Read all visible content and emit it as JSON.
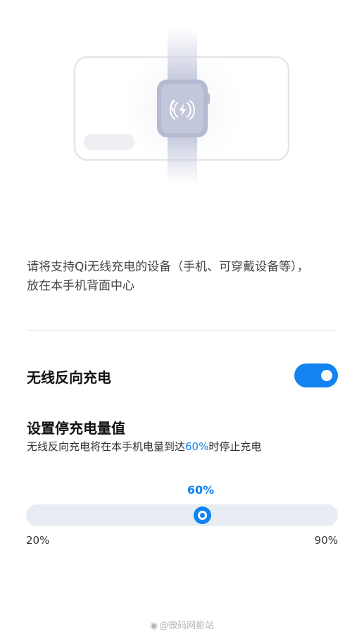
{
  "illustration": {
    "icon": "wireless-charging-icon"
  },
  "instruction": {
    "line1": "请将支持Qi无线充电的设备（手机、可穿戴设备等），",
    "line2": "放在本手机背面中心"
  },
  "reverse_charging": {
    "label": "无线反向充电",
    "enabled": true
  },
  "threshold": {
    "title": "设置停充电量值",
    "desc_prefix": "无线反向充电将在本手机电量到达",
    "desc_value": "60%",
    "desc_suffix": "时停止充电",
    "slider_value": "60%",
    "value": 60,
    "min": 20,
    "max": 90,
    "min_label": "20%",
    "max_label": "90%"
  },
  "watermark": {
    "text": "@微码网影站"
  },
  "colors": {
    "accent": "#1283f0",
    "track": "#e8edf4"
  }
}
